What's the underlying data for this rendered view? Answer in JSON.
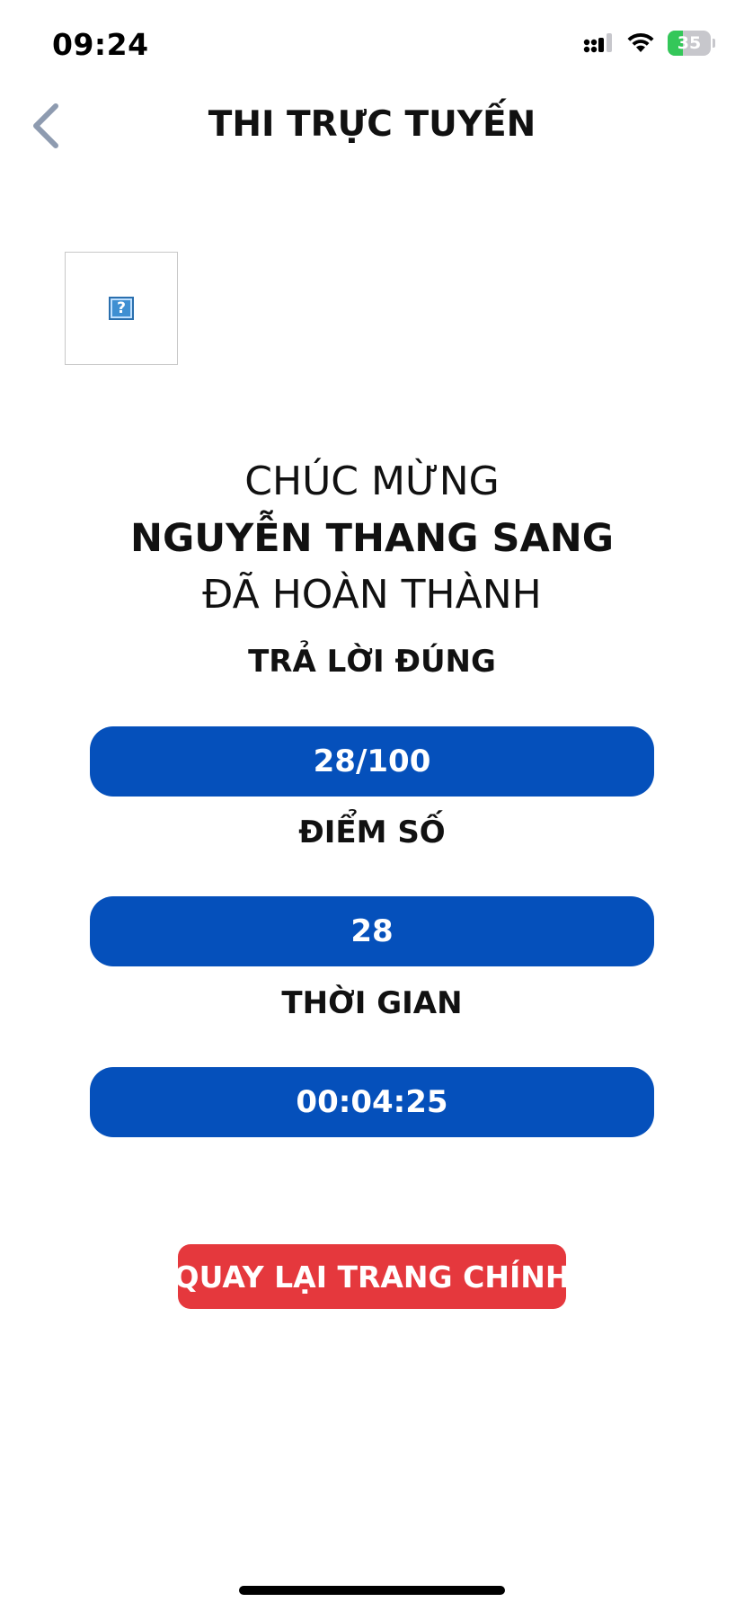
{
  "status_bar": {
    "time": "09:24",
    "battery_level": "35",
    "battery_fraction": 0.35,
    "signal_icon": "cellular-signal-icon",
    "wifi_icon": "wifi-icon",
    "battery_icon": "battery-charging-icon"
  },
  "header": {
    "title": "THI TRỰC TUYẾN",
    "back_icon": "chevron-left-icon"
  },
  "broken_image": {
    "glyph": "?"
  },
  "result": {
    "congrats": "CHÚC MỪNG",
    "name": "NGUYỄN THANG SANG",
    "completed": "ĐÃ HOÀN THÀNH"
  },
  "stats": {
    "correct_label": "TRẢ LỜI ĐÚNG",
    "correct_value": "28/100",
    "score_label": "ĐIỂM SỐ",
    "score_value": "28",
    "time_label": "THỜI GIAN",
    "time_value": "00:04:25"
  },
  "actions": {
    "home_label": "QUAY LẠI TRANG CHÍNH"
  },
  "colors": {
    "pill_blue": "#0550bb",
    "button_red": "#e5383d",
    "back_chevron": "#8e9bb0",
    "battery_green": "#34c759"
  }
}
